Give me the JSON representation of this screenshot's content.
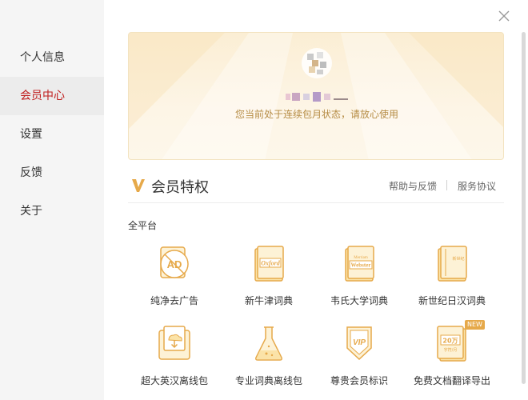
{
  "sidebar": {
    "items": [
      {
        "label": "个人信息"
      },
      {
        "label": "会员中心"
      },
      {
        "label": "设置"
      },
      {
        "label": "反馈"
      },
      {
        "label": "关于"
      }
    ],
    "active_index": 1
  },
  "banner": {
    "status_text": "您当前处于连续包月状态，请放心使用"
  },
  "section": {
    "title": "会员特权",
    "help_link": "帮助与反馈",
    "agreement_link": "服务协议"
  },
  "platform_label": "全平台",
  "features": [
    {
      "label": "纯净去广告",
      "icon": "ad-free-icon"
    },
    {
      "label": "新牛津词典",
      "icon": "oxford-dictionary-icon"
    },
    {
      "label": "韦氏大学词典",
      "icon": "webster-dictionary-icon"
    },
    {
      "label": "新世纪日汉词典",
      "icon": "japanese-dictionary-icon"
    },
    {
      "label": "超大英汉离线包",
      "icon": "offline-package-icon"
    },
    {
      "label": "专业词典离线包",
      "icon": "professional-dictionary-icon"
    },
    {
      "label": "尊贵会员标识",
      "icon": "vip-badge-icon"
    },
    {
      "label": "免费文档翻译导出",
      "icon": "document-translate-icon"
    }
  ],
  "icon_text": {
    "ad": "AD",
    "oxford": "Oxford",
    "webster_top": "Merriam",
    "webster": "Webster",
    "japanese": "新世纪",
    "vip": "VIP",
    "doc_amount": "20万",
    "doc_unit": "字符/月",
    "new_badge": "NEW"
  },
  "colors": {
    "accent_red": "#c01e1e",
    "gold": "#e6a94a",
    "gold_light": "#fbe3a8"
  }
}
